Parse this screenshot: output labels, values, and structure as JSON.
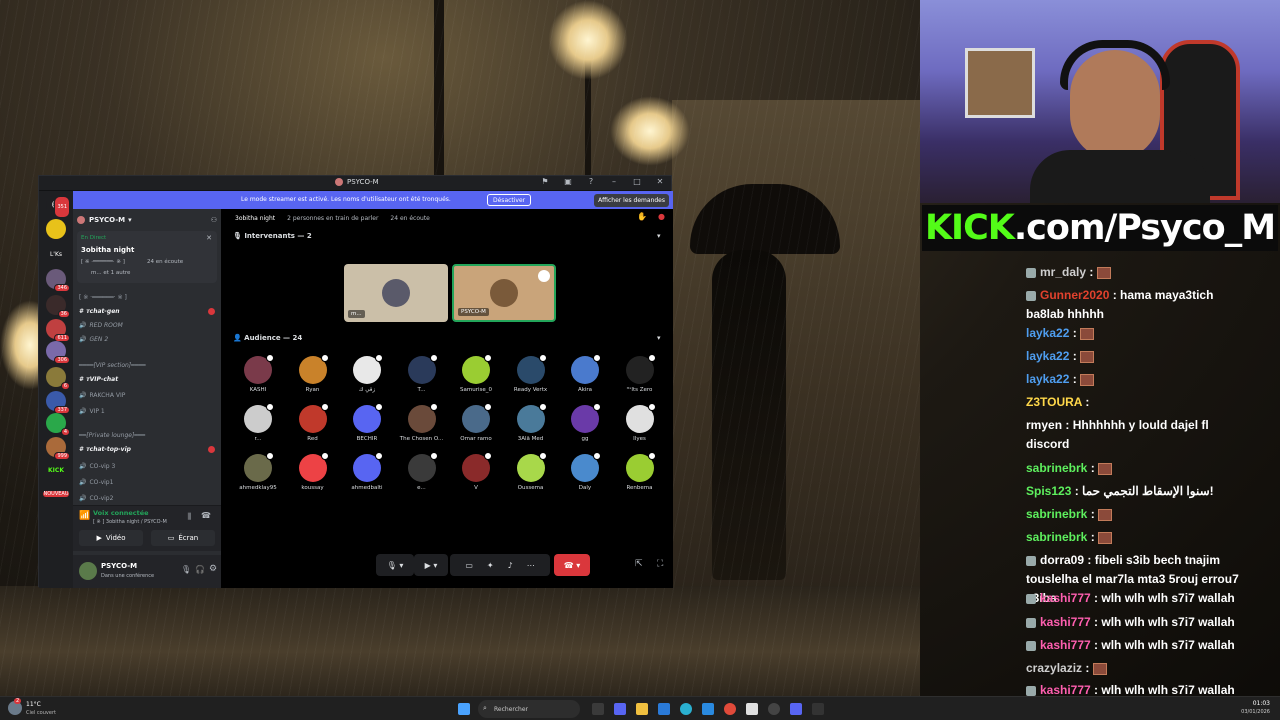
{
  "discord": {
    "window_title": "PSYCO-M",
    "banner_text": "Le mode streamer est activé. Les noms d'utilisateur ont été tronqués.",
    "banner_button": "Désactiver",
    "requests_button": "Afficher les demandes",
    "server_name": "PSYCO-M",
    "live_label": "En Direct",
    "live_title": "3obitha night",
    "live_meta": "24 en écoute",
    "live_sub": "m... et 1 autre",
    "channels": [
      {
        "label": "[ ※ ·══════· ※ ]",
        "type": "category"
      },
      {
        "label": "ᴛchat-gen",
        "type": "text"
      },
      {
        "label": "RED ROOM",
        "type": "voice"
      },
      {
        "label": "GEN 2",
        "type": "voice"
      },
      {
        "label": "━━━━[VIP section]━━━━",
        "type": "category"
      },
      {
        "label": "ᴛVIP-chat",
        "type": "text"
      },
      {
        "label": "RAKCHA VIP",
        "type": "voice"
      },
      {
        "label": "VIP 1",
        "type": "voice"
      },
      {
        "label": "━━[Private lounge]━━━",
        "type": "category"
      },
      {
        "label": "ᴛchat-top-vip",
        "type": "text"
      },
      {
        "label": "CO-vip 3",
        "type": "voice"
      },
      {
        "label": "CO-vip1",
        "type": "voice"
      },
      {
        "label": "CO-vip2",
        "type": "voice"
      }
    ],
    "guild_badges": [
      "351",
      "346",
      "36",
      "611",
      "306",
      "6",
      "337",
      "4",
      "999",
      "6"
    ],
    "guild_labels": [
      "L'Ks",
      "KICK",
      "NOUVEAU"
    ],
    "voice_connected": "Voix connectée",
    "voice_detail": "[ ※ ] 3obitha night / PSYCO-M",
    "video_button": "Vidéo",
    "screen_button": "Écran",
    "user_name": "PSYCO-M",
    "user_status": "Dans une conférence",
    "stage_title": "3obitha night",
    "stage_speaking": "2 personnes en train de parler",
    "stage_listening": "24 en écoute",
    "speakers_header": "Intervenants — 2",
    "audience_header": "Audience — 24",
    "speakers": [
      {
        "name": "m..."
      },
      {
        "name": "PSYCO-M"
      }
    ],
    "audience": [
      {
        "name": "KASHI",
        "color": "#7a3a4a"
      },
      {
        "name": "Ryan",
        "color": "#c9822a"
      },
      {
        "name": "زقي ك",
        "color": "#e8e8e8"
      },
      {
        "name": "T...",
        "color": "#2a3a5a"
      },
      {
        "name": "Samurise_0",
        "color": "#9acd32"
      },
      {
        "name": "Ready Vertx",
        "color": "#2a4a6a"
      },
      {
        "name": "Akira",
        "color": "#4a7acd"
      },
      {
        "name": "ᴵᵗˢIts Zero",
        "color": "#222222"
      },
      {
        "name": "r...",
        "color": "#cccccc"
      },
      {
        "name": "Red",
        "color": "#c0392b"
      },
      {
        "name": "BECHIR",
        "color": "#5865f2"
      },
      {
        "name": "The Chosen O...",
        "color": "#6a4a3a"
      },
      {
        "name": "Omar ramo",
        "color": "#4a6a8a"
      },
      {
        "name": "3Alā Med",
        "color": "#4a7a9a"
      },
      {
        "name": "gg",
        "color": "#6a3aa8"
      },
      {
        "name": "Ilyes",
        "color": "#e0e0e0"
      },
      {
        "name": "ahmedklay95",
        "color": "#6a6a4a"
      },
      {
        "name": "koussay",
        "color": "#ed4245"
      },
      {
        "name": "ahmedbalti",
        "color": "#5865f2"
      },
      {
        "name": "e...",
        "color": "#3a3a3a"
      },
      {
        "name": "V",
        "color": "#8a2a2a"
      },
      {
        "name": "Oussema",
        "color": "#a8d84a"
      },
      {
        "name": "Daly",
        "color": "#4a8acd"
      },
      {
        "name": "Renbema",
        "color": "#9acd32"
      }
    ],
    "stage_header_badges": [
      "34"
    ]
  },
  "overlay": {
    "kick_prefix": "KICK",
    "kick_suffix": ".com/Psyco_M"
  },
  "chat": [
    {
      "user": "mr_daly",
      "color": "#cfcfcf",
      "text": "",
      "emote": true,
      "icon": true
    },
    {
      "user": "Gunner2020",
      "color": "#e0412d",
      "text": "hama maya3tich ba8lab hhhhh",
      "emote": false,
      "icon": true
    },
    {
      "user": "layka22",
      "color": "#4f9ef0",
      "text": "",
      "emote": true,
      "icon": false
    },
    {
      "user": "layka22",
      "color": "#4f9ef0",
      "text": "",
      "emote": true,
      "icon": false
    },
    {
      "user": "layka22",
      "color": "#4f9ef0",
      "text": "",
      "emote": true,
      "icon": false
    },
    {
      "user": "Z3TOURA",
      "color": "#ffd84a",
      "text": "",
      "emote": false,
      "icon": false
    },
    {
      "user": "rmyen",
      "color": "#ffffff",
      "text": "Hhhhhhh y lould dajel fl discord",
      "emote": false,
      "icon": false
    },
    {
      "user": "sabrinebrk",
      "color": "#5ef05e",
      "text": "",
      "emote": true,
      "icon": false
    },
    {
      "user": "Spis123",
      "color": "#5ef05e",
      "text": "سنوا الإسقاط التجمي حما!",
      "emote": false,
      "icon": false
    },
    {
      "user": "sabrinebrk",
      "color": "#5ef05e",
      "text": "",
      "emote": true,
      "icon": false
    },
    {
      "user": "sabrinebrk",
      "color": "#5ef05e",
      "text": "",
      "emote": true,
      "icon": false
    },
    {
      "user": "dorra09",
      "color": "#ffffff",
      "text": "fibeli s3ib bech tnajim touslelha el mar7la mta3 5rouj errou7 s3iba",
      "emote": false,
      "icon": true
    },
    {
      "user": "kashi777",
      "color": "#ff5fb0",
      "text": "wlh wlh wlh s7i7 wallah",
      "emote": false,
      "icon": true
    },
    {
      "user": "kashi777",
      "color": "#ff5fb0",
      "text": "wlh wlh wlh s7i7 wallah",
      "emote": false,
      "icon": true
    },
    {
      "user": "kashi777",
      "color": "#ff5fb0",
      "text": "wlh wlh wlh s7i7 wallah",
      "emote": false,
      "icon": true
    },
    {
      "user": "crazylaziz",
      "color": "#cfcfcf",
      "text": "",
      "emote": true,
      "icon": false
    },
    {
      "user": "kashi777",
      "color": "#ff5fb0",
      "text": "wlh wlh wlh s7i7 wallah",
      "emote": false,
      "icon": true
    }
  ],
  "taskbar": {
    "weather_temp": "11°C",
    "weather_desc": "Ciel couvert",
    "weather_badge": "2",
    "search_placeholder": "Rechercher",
    "time": "01:03",
    "date": "03/01/2026"
  }
}
